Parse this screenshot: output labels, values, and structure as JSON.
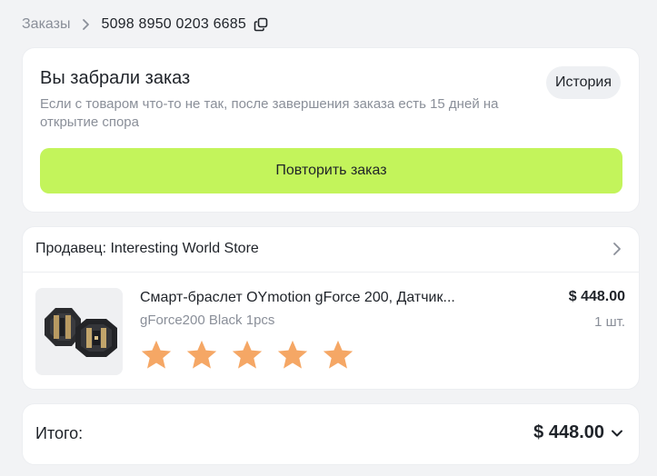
{
  "breadcrumb": {
    "parent": "Заказы",
    "order_number": "5098 8950 0203 6685"
  },
  "status": {
    "title": "Вы забрали заказ",
    "description": "Если с товаром что-то не так, после завершения заказа есть 15 дней на открытие спора",
    "history_label": "История",
    "repeat_label": "Повторить заказ"
  },
  "seller": {
    "label": "Продавец: Interesting World Store"
  },
  "product": {
    "name": "Смарт-браслет OYmotion gForce 200, Датчик...",
    "variant": "gForce200 Black 1pcs",
    "price": "$ 448.00",
    "quantity": "1 шт.",
    "rating": {
      "value": 5,
      "max": 5
    }
  },
  "total": {
    "label": "Итого:",
    "value": "$ 448.00"
  },
  "colors": {
    "accent": "#c3f45b",
    "star": "#f5a765",
    "muted_text": "#8a8f99",
    "background": "#f2f3f5"
  },
  "icons": {
    "breadcrumb_separator": "chevron-right-icon",
    "copy": "copy-icon",
    "seller_chevron": "chevron-right-icon",
    "total_chevron": "chevron-down-icon",
    "rating": "star-icon"
  }
}
